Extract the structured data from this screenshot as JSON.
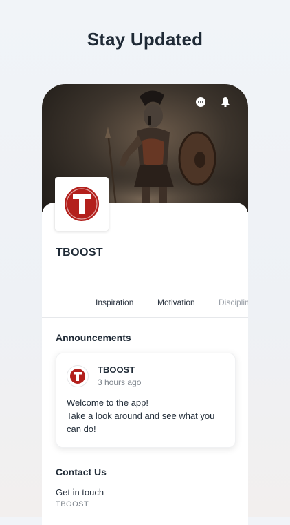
{
  "headline": "Stay Updated",
  "hero": {
    "icons": [
      "chat-bubble-icon",
      "bell-icon"
    ],
    "image": "spartan-warrior-photo"
  },
  "brand": {
    "name": "TBOOST",
    "logo_letter": "T",
    "logo_color": "#b3201c"
  },
  "tabs": [
    {
      "label": "Inspiration"
    },
    {
      "label": "Motivation"
    },
    {
      "label": "Disciplin"
    }
  ],
  "announcements": {
    "title": "Announcements",
    "post": {
      "author": "TBOOST",
      "time": "3 hours ago",
      "body": "Welcome to the app!\nTake a look around and see what you can do!"
    }
  },
  "contact": {
    "title": "Contact Us",
    "line": "Get in touch",
    "sub": "TBOOST"
  }
}
